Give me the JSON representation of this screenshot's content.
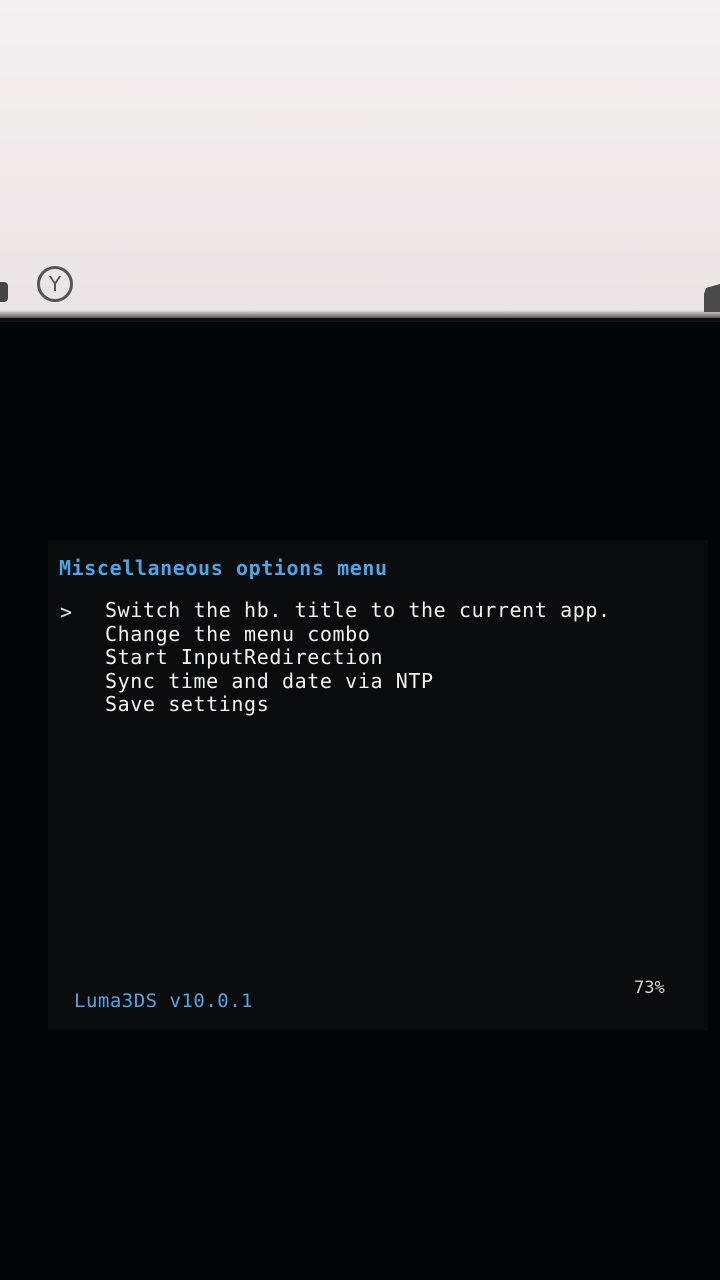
{
  "top_screen": {
    "y_button_label": "Y"
  },
  "menu": {
    "title": "Miscellaneous options menu",
    "cursor": ">",
    "selected_index": 0,
    "items": [
      {
        "label": "Switch the hb. title to the current app."
      },
      {
        "label": "Change the menu combo"
      },
      {
        "label": "Start InputRedirection"
      },
      {
        "label": "Sync time and date via NTP"
      },
      {
        "label": "Save settings"
      }
    ]
  },
  "footer": {
    "version": "Luma3DS v10.0.1",
    "battery": "73%"
  },
  "colors": {
    "title": "#4aa6e8",
    "item_text": "#f2f2ee",
    "background": "#0a0b0d"
  }
}
